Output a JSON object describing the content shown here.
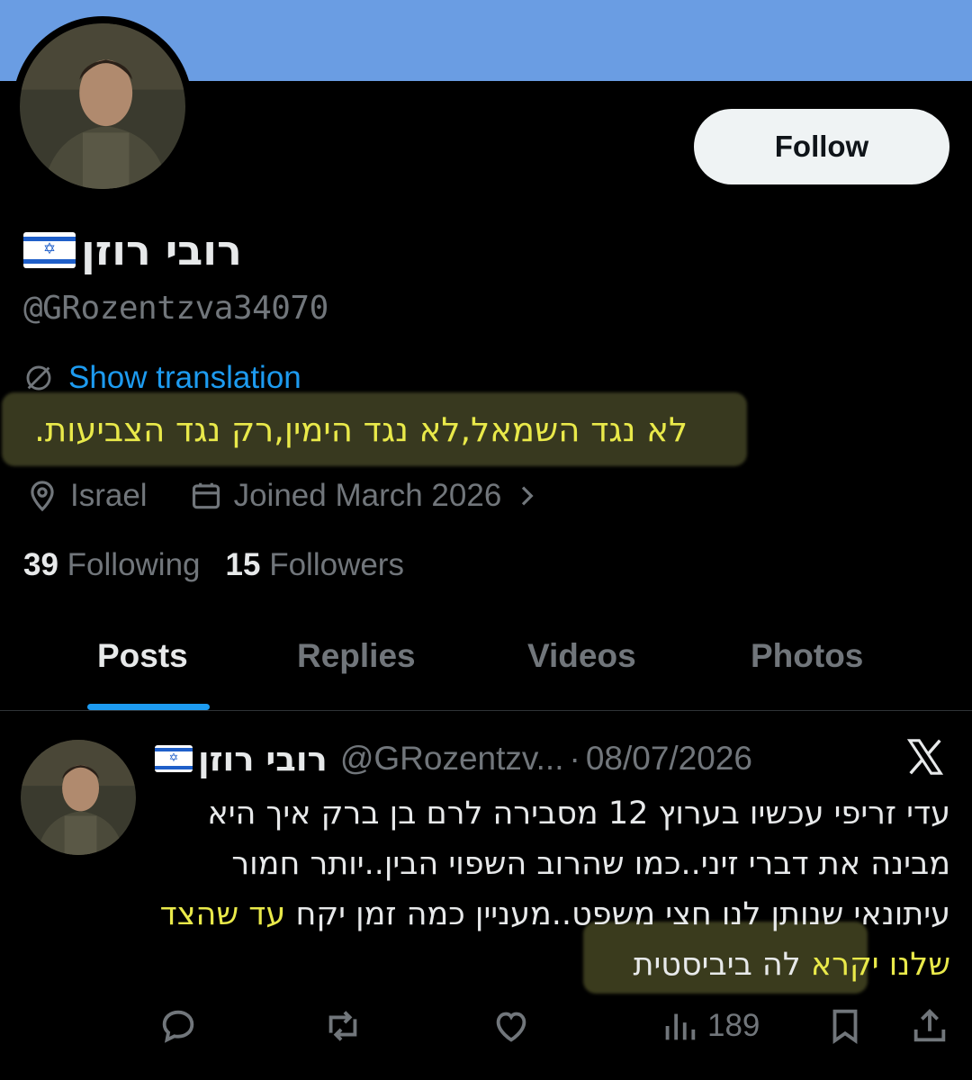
{
  "profile": {
    "display_name": "רובי רוזן",
    "flag": "israel-flag-emoji",
    "handle": "@GRozentzva34070",
    "follow_label": "Follow",
    "translate_label": "Show translation",
    "bio": "לא נגד השמאל,לא נגד הימין,רק נגד הצביעות.",
    "location": "Israel",
    "joined": "Joined March 2026",
    "following_count": "39",
    "following_label": "Following",
    "followers_count": "15",
    "followers_label": "Followers"
  },
  "tabs": [
    "Posts",
    "Replies",
    "Videos",
    "Photos"
  ],
  "post": {
    "author_name": "רובי רוזן",
    "author_handle": "@GRozentzv...",
    "separator": "·",
    "date": "08/07/2026",
    "text_part1": "עדי זריפי עכשיו בערוץ 12 מסבירה לרם בן ברק איך היא מבינה את דברי זיני..כמו שהרוב השפוי הבין..יותר חמור עיתונאי שנותן לנו חצי משפט..מעניין כמה זמן יקח ",
    "text_highlight": "עד שהצד שלנו יקרא",
    "text_part2": " לה ביביסטית",
    "views": "189"
  },
  "colors": {
    "background": "#000000",
    "banner": "#6a9de3",
    "accent": "#1d9bf0",
    "muted": "#71767b",
    "highlight": "#e9e94a"
  }
}
